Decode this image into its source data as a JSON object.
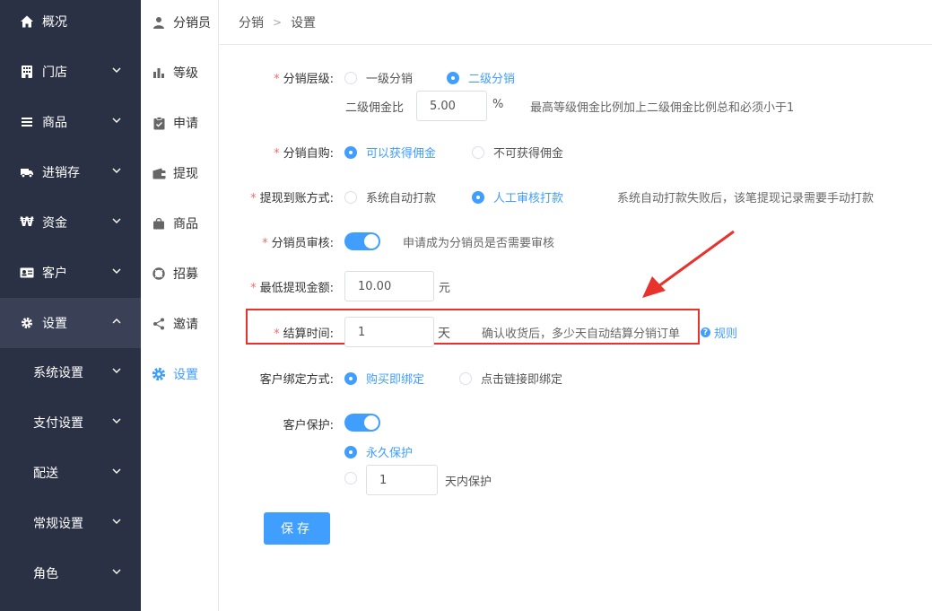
{
  "colors": {
    "accent": "#409eff",
    "sidebar": "#2b3145",
    "required": "#f56c6c",
    "annotation": "#e8322c"
  },
  "sidebar": {
    "items": [
      {
        "label": "概况",
        "icon": "home-icon"
      },
      {
        "label": "门店",
        "icon": "store-icon"
      },
      {
        "label": "商品",
        "icon": "list-icon"
      },
      {
        "label": "进销存",
        "icon": "truck-icon"
      },
      {
        "label": "资金",
        "icon": "currency-icon"
      },
      {
        "label": "客户",
        "icon": "id-card-icon"
      },
      {
        "label": "设置",
        "icon": "gear-icon"
      }
    ],
    "sub_items": [
      {
        "label": "系统设置"
      },
      {
        "label": "支付设置"
      },
      {
        "label": "配送"
      },
      {
        "label": "常规设置"
      },
      {
        "label": "角色"
      }
    ]
  },
  "subnav": {
    "items": [
      {
        "label": "分销员",
        "icon": "user-icon"
      },
      {
        "label": "等级",
        "icon": "bar-chart-icon"
      },
      {
        "label": "申请",
        "icon": "clipboard-icon"
      },
      {
        "label": "提现",
        "icon": "wallet-icon"
      },
      {
        "label": "商品",
        "icon": "bag-icon"
      },
      {
        "label": "招募",
        "icon": "lifebuoy-icon"
      },
      {
        "label": "邀请",
        "icon": "share-icon"
      },
      {
        "label": "设置",
        "icon": "gear-icon"
      }
    ]
  },
  "breadcrumb": {
    "first": "分销",
    "second": "设置"
  },
  "form": {
    "level": {
      "label": "分销层级:",
      "option1": "一级分销",
      "option2": "二级分销",
      "selected": "二级分销",
      "ratio_label": "二级佣金比",
      "ratio_value": "5.00",
      "ratio_unit": "%",
      "ratio_hint": "最高等级佣金比例加上二级佣金比例总和必须小于1"
    },
    "self_buy": {
      "label": "分销自购:",
      "option1": "可以获得佣金",
      "option2": "不可获得佣金",
      "selected": "可以获得佣金"
    },
    "withdraw_method": {
      "label": "提现到账方式:",
      "option1": "系统自动打款",
      "option2": "人工审核打款",
      "selected": "人工审核打款",
      "hint": "系统自动打款失败后，该笔提现记录需要手动打款"
    },
    "review": {
      "label": "分销员审核:",
      "enabled": true,
      "hint": "申请成为分销员是否需要审核"
    },
    "min_withdraw": {
      "label": "最低提现金额:",
      "value": "10.00",
      "unit": "元"
    },
    "settle_time": {
      "label": "结算时间:",
      "value": "1",
      "unit": "天",
      "hint": "确认收货后，多少天自动结算分销订单",
      "rules_link": "规则"
    },
    "bind_method": {
      "label": "客户绑定方式:",
      "option1": "购买即绑定",
      "option2": "点击链接即绑定",
      "selected": "购买即绑定"
    },
    "protect": {
      "label": "客户保护:",
      "enabled": true,
      "option1": "永久保护",
      "option2_value": "1",
      "option2_suffix": "天内保护",
      "selected": "永久保护"
    },
    "save_label": "保存"
  }
}
